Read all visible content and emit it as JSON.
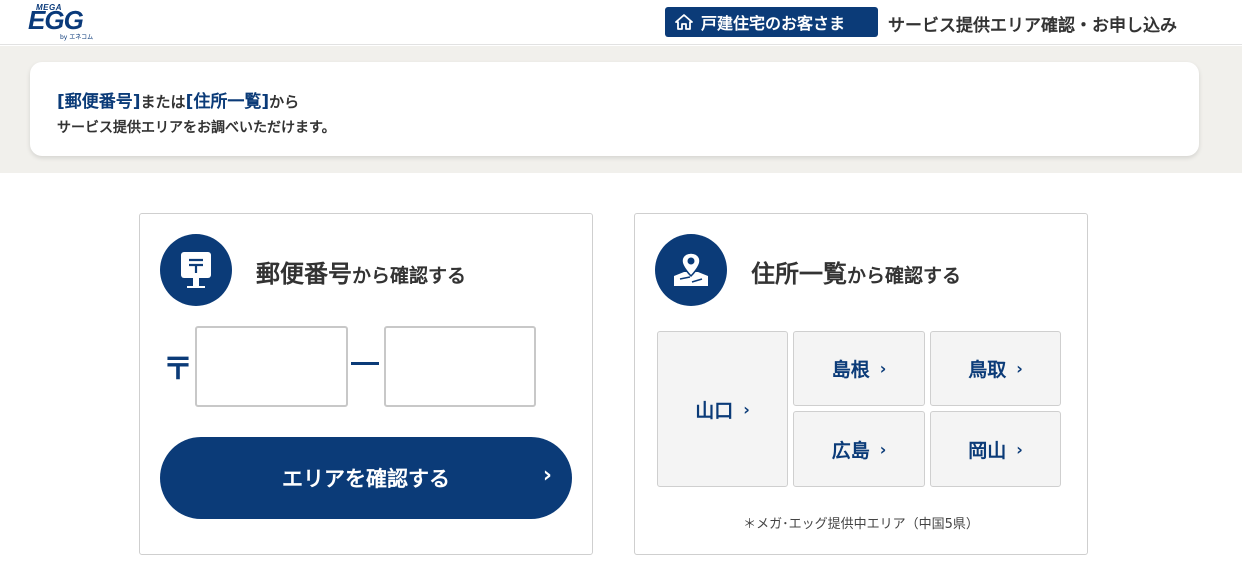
{
  "header": {
    "logo_top": "MEGA",
    "logo_main": "EGG",
    "logo_by": "by エネコム",
    "badge_label": "戸建住宅のお客さま",
    "link_label": "サービス提供エリア確認・お申し込み"
  },
  "banner": {
    "hl1": "[郵便番号]",
    "mid": "または",
    "hl2": "[住所一覧]",
    "end": "から",
    "line2": "サービス提供エリアをお調べいただけます。"
  },
  "postal": {
    "title_big": "郵便番号",
    "title_small": "から確認する",
    "mark": "〒",
    "zip1_value": "",
    "zip2_value": "",
    "button_label": "エリアを確認する",
    "button_arrow": "›"
  },
  "address": {
    "title_big": "住所一覧",
    "title_small": "から確認する",
    "prefectures": [
      {
        "label": "山口",
        "chev": "›"
      },
      {
        "label": "島根",
        "chev": "›"
      },
      {
        "label": "鳥取",
        "chev": "›"
      },
      {
        "label": "広島",
        "chev": "›"
      },
      {
        "label": "岡山",
        "chev": "›"
      }
    ],
    "note": "＊メガ･エッグ提供中エリア（中国5県）"
  },
  "colors": {
    "brand": "#0b3b78",
    "banner_bg": "#f1f0ec"
  },
  "icons": {
    "home": "home-icon",
    "postbox": "postbox-icon",
    "map_pin": "map-pin-icon"
  }
}
